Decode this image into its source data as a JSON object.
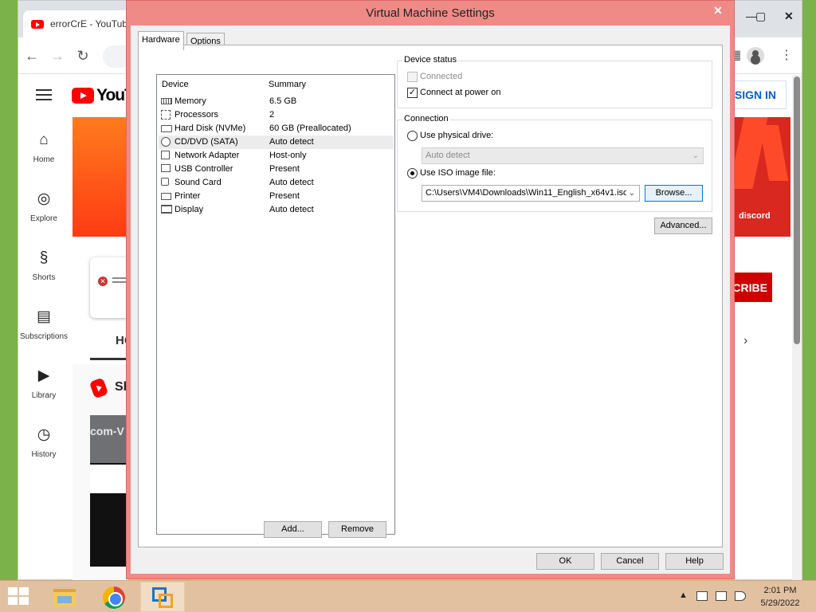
{
  "browser": {
    "tab_title": "errorCrE - YouTube",
    "nav": {
      "back_icon": "←",
      "forward_icon": "→",
      "reload_icon": "↻",
      "menu_icon": "⋮",
      "grid_icon": "▦"
    }
  },
  "youtube": {
    "logo_text": "YouTube",
    "sign_in_label": "SIGN IN",
    "guide": [
      {
        "label": "Home",
        "icon": "⌂"
      },
      {
        "label": "Explore",
        "icon": "◎"
      },
      {
        "label": "Shorts",
        "icon": "§"
      },
      {
        "label": "Subscriptions",
        "icon": "▤"
      },
      {
        "label": "Library",
        "icon": "▶"
      },
      {
        "label": "History",
        "icon": "◷"
      }
    ],
    "banner_text": "discord",
    "home_tab": "HOME",
    "subscribe_label": "SUBSCRIBE",
    "shorts_title": "Shorts",
    "thumb_text": "com-V"
  },
  "dialog": {
    "title": "Virtual Machine Settings",
    "close_glyph": "✕",
    "tabs": [
      "Hardware",
      "Options"
    ],
    "device_table": {
      "headers": [
        "Device",
        "Summary"
      ],
      "rows": [
        {
          "device": "Memory",
          "summary": "6.5 GB",
          "icon": "memory-icon"
        },
        {
          "device": "Processors",
          "summary": "2",
          "icon": "processor-icon"
        },
        {
          "device": "Hard Disk (NVMe)",
          "summary": "60 GB (Preallocated)",
          "icon": "hard-disk-icon"
        },
        {
          "device": "CD/DVD (SATA)",
          "summary": "Auto detect",
          "icon": "cd-dvd-icon",
          "selected": true
        },
        {
          "device": "Network Adapter",
          "summary": "Host-only",
          "icon": "network-adapter-icon"
        },
        {
          "device": "USB Controller",
          "summary": "Present",
          "icon": "usb-icon"
        },
        {
          "device": "Sound Card",
          "summary": "Auto detect",
          "icon": "sound-card-icon"
        },
        {
          "device": "Printer",
          "summary": "Present",
          "icon": "printer-icon"
        },
        {
          "device": "Display",
          "summary": "Auto detect",
          "icon": "display-icon"
        }
      ]
    },
    "add_label": "Add...",
    "remove_label": "Remove",
    "device_status": {
      "label": "Device status",
      "connected_label": "Connected",
      "connected_checked": false,
      "connect_power_label": "Connect at power on",
      "connect_power_checked": true,
      "check_glyph": "✓"
    },
    "connection": {
      "label": "Connection",
      "physical_label": "Use physical drive:",
      "physical_value": "Auto detect",
      "iso_label": "Use ISO image file:",
      "iso_path": "C:\\Users\\VM4\\Downloads\\Win11_English_x64v1.iso",
      "selected": "iso",
      "arrow_glyph": "⌄"
    },
    "browse_label": "Browse...",
    "advanced_label": "Advanced...",
    "ok_label": "OK",
    "cancel_label": "Cancel",
    "help_label": "Help"
  },
  "taskbar": {
    "clock_time": "2:01 PM",
    "clock_date": "5/29/2022",
    "tray_arrow": "▲"
  },
  "colors": {
    "dialog_frame": "#f08a86",
    "taskbar": "#e2c1a0",
    "youtube_red": "#ff0000"
  }
}
